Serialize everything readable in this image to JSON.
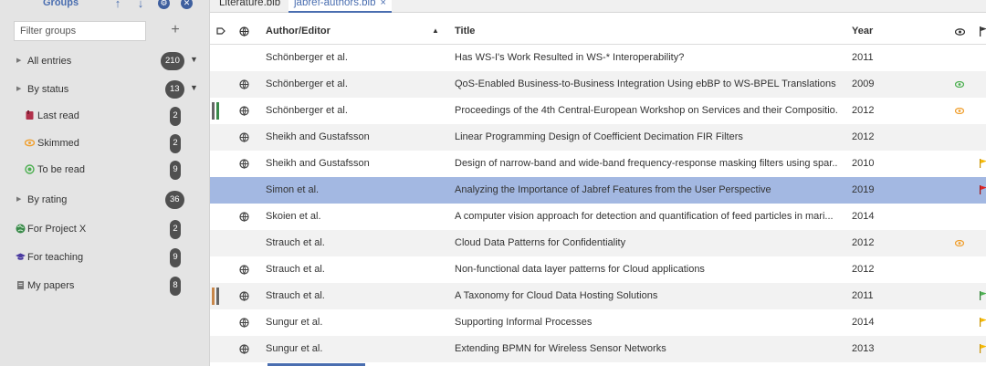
{
  "sidebar": {
    "title": "Groups",
    "filter_placeholder": "Filter groups",
    "add_symbol": "+",
    "groups": [
      {
        "label": "All entries",
        "count": "210"
      },
      {
        "label": "By status",
        "count": "13"
      },
      {
        "label": "Last read",
        "count": "2"
      },
      {
        "label": "Skimmed",
        "count": "2"
      },
      {
        "label": "To be read",
        "count": "9"
      },
      {
        "label": "By rating",
        "count": "36"
      },
      {
        "label": "For Project X",
        "count": "2"
      },
      {
        "label": "For teaching",
        "count": "9"
      },
      {
        "label": "My papers",
        "count": "8"
      }
    ]
  },
  "tabs": [
    {
      "label": "Literature.bib"
    },
    {
      "label": "jabref-authors.bib",
      "close": "×"
    }
  ],
  "table": {
    "columns": {
      "author": "Author/Editor",
      "title": "Title",
      "year": "Year"
    },
    "rows": [
      {
        "author": "Schönberger et al.",
        "title": "Has WS-I's Work Resulted in WS-* Interoperability?",
        "year": "2011"
      },
      {
        "author": "Schönberger et al.",
        "title": "QoS-Enabled Business-to-Business Integration Using ebBP to WS-BPEL Translations",
        "year": "2009"
      },
      {
        "author": "Schönberger et al.",
        "title": "Proceedings of the 4th Central-European Workshop on Services and their Compositio...",
        "year": "2012"
      },
      {
        "author": "Sheikh and Gustafsson",
        "title": "Linear Programming Design of Coefficient Decimation FIR Filters",
        "year": "2012"
      },
      {
        "author": "Sheikh and Gustafsson",
        "title": "Design of narrow-band and wide-band frequency-response masking filters using spar...",
        "year": "2010"
      },
      {
        "author": "Simon et al.",
        "title": "Analyzing the Importance of Jabref Features from the User Perspective",
        "year": "2019"
      },
      {
        "author": "Skoien et al.",
        "title": "A computer vision approach for detection and quantification of feed particles in mari...",
        "year": "2014"
      },
      {
        "author": "Strauch et al.",
        "title": "Cloud Data Patterns for Confidentiality",
        "year": "2012"
      },
      {
        "author": "Strauch et al.",
        "title": "Non-functional data layer patterns for Cloud applications",
        "year": "2012"
      },
      {
        "author": "Strauch et al.",
        "title": "A Taxonomy for Cloud Data Hosting Solutions",
        "year": "2011"
      },
      {
        "author": "Sungur et al.",
        "title": "Supporting Informal Processes",
        "year": "2014"
      },
      {
        "author": "Sungur et al.",
        "title": "Extending BPMN for Wireless Sensor Networks",
        "year": "2013"
      }
    ]
  },
  "colors": {
    "accent": "#4a6eb0",
    "selected_row": "#a3b8e2",
    "skimmed": "#f0a030",
    "to_be_read": "#4caf50",
    "flag_yellow": "#f5b800",
    "flag_red": "#e02020",
    "flag_green": "#4caf50",
    "last_read": "#b0304a"
  }
}
